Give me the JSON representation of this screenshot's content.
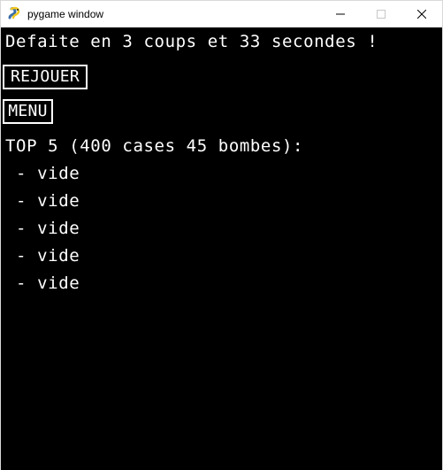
{
  "window": {
    "title": "pygame window",
    "controls": {
      "minimize_icon": "minimize-icon",
      "maximize_icon": "maximize-icon",
      "close_icon": "close-icon"
    }
  },
  "game": {
    "result_message": "Defaite en 3 coups et 33 secondes !",
    "replay_label": "REJOUER",
    "menu_label": "MENU",
    "leaderboard_title": "TOP 5 (400 cases 45 bombes):",
    "leaderboard_entries": [
      " - vide",
      " - vide",
      " - vide",
      " - vide",
      " - vide"
    ]
  },
  "colors": {
    "background": "#000000",
    "text": "#ffffff",
    "titlebar": "#ffffff"
  }
}
